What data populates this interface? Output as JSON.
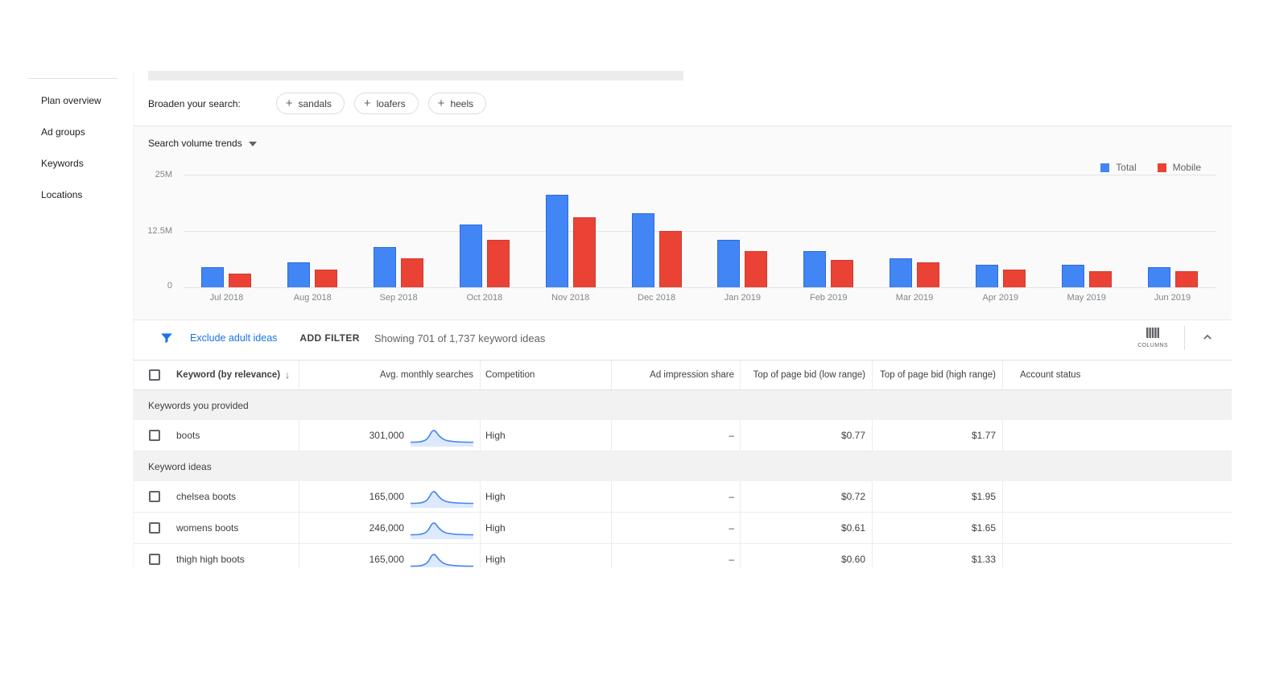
{
  "colors": {
    "total_blue": "#4285f4",
    "mobile_red": "#ea4335",
    "link_blue": "#1a73e8"
  },
  "sidebar": {
    "items": [
      {
        "label": "Plan overview"
      },
      {
        "label": "Ad groups"
      },
      {
        "label": "Keywords"
      },
      {
        "label": "Locations"
      }
    ]
  },
  "broaden": {
    "label": "Broaden your search:",
    "chips": [
      {
        "label": "sandals"
      },
      {
        "label": "loafers"
      },
      {
        "label": "heels"
      }
    ]
  },
  "trends": {
    "title": "Search volume trends"
  },
  "chart_data": {
    "type": "bar",
    "title": "Search volume trends",
    "categories": [
      "Jul 2018",
      "Aug 2018",
      "Sep 2018",
      "Oct 2018",
      "Nov 2018",
      "Dec 2018",
      "Jan 2019",
      "Feb 2019",
      "Mar 2019",
      "Apr 2019",
      "May 2019",
      "Jun 2019"
    ],
    "series": [
      {
        "name": "Total",
        "color": "#4285f4",
        "values_millions": [
          4.5,
          5.5,
          9,
          14,
          20.5,
          16.5,
          10.5,
          8,
          6.5,
          5,
          5,
          4.5
        ]
      },
      {
        "name": "Mobile",
        "color": "#ea4335",
        "values_millions": [
          3,
          4,
          6.5,
          10.5,
          15.5,
          12.5,
          8,
          6,
          5.5,
          4,
          3.5,
          3.5
        ]
      }
    ],
    "ylim_millions": [
      0,
      25
    ],
    "yticks": [
      "25M",
      "12.5M",
      "0"
    ],
    "legend_position": "top-right",
    "grid": true
  },
  "filter_bar": {
    "exclude_link": "Exclude adult ideas",
    "add_filter": "ADD FILTER",
    "showing": "Showing 701 of 1,737 keyword ideas",
    "columns_label": "COLUMNS"
  },
  "table": {
    "columns": [
      {
        "label": "Keyword (by relevance)",
        "sort": "desc"
      },
      {
        "label": "Avg. monthly searches"
      },
      {
        "label": "Competition"
      },
      {
        "label": "Ad impression share"
      },
      {
        "label": "Top of page bid (low range)"
      },
      {
        "label": "Top of page bid (high range)"
      },
      {
        "label": "Account status"
      }
    ],
    "sparkline_shape": [
      1,
      1,
      1.3,
      2.5,
      8,
      4,
      2,
      1.5,
      1.2,
      1.1,
      1,
      1
    ],
    "sections": [
      {
        "label": "Keywords you provided",
        "rows": [
          {
            "keyword": "boots",
            "avg_monthly_searches": "301,000",
            "competition": "High",
            "ad_impression_share": "–",
            "top_of_page_bid_low": "$0.77",
            "top_of_page_bid_high": "$1.77",
            "account_status": ""
          }
        ]
      },
      {
        "label": "Keyword ideas",
        "rows": [
          {
            "keyword": "chelsea boots",
            "avg_monthly_searches": "165,000",
            "competition": "High",
            "ad_impression_share": "–",
            "top_of_page_bid_low": "$0.72",
            "top_of_page_bid_high": "$1.95",
            "account_status": ""
          },
          {
            "keyword": "womens boots",
            "avg_monthly_searches": "246,000",
            "competition": "High",
            "ad_impression_share": "–",
            "top_of_page_bid_low": "$0.61",
            "top_of_page_bid_high": "$1.65",
            "account_status": ""
          },
          {
            "keyword": "thigh high boots",
            "avg_monthly_searches": "165,000",
            "competition": "High",
            "ad_impression_share": "–",
            "top_of_page_bid_low": "$0.60",
            "top_of_page_bid_high": "$1.33",
            "account_status": ""
          }
        ]
      }
    ]
  }
}
